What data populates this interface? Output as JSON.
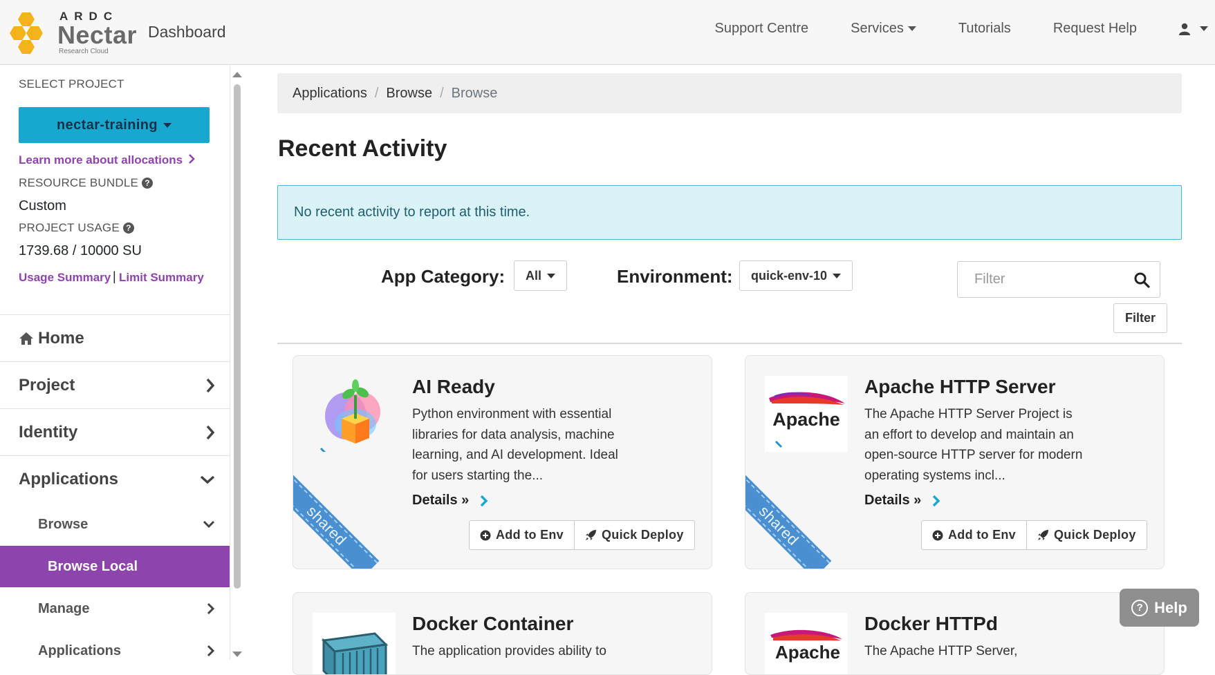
{
  "header": {
    "brand_small": "ARDC",
    "brand_big": "Nectar",
    "brand_sub": "Research Cloud",
    "dashboard_label": "Dashboard",
    "nav": [
      "Support Centre",
      "Services",
      "Tutorials",
      "Request Help"
    ],
    "brand_color": "#f4b21b"
  },
  "sidebar": {
    "select_project_label": "SELECT PROJECT",
    "project_name": "nectar-training",
    "learn_more": "Learn more about allocations",
    "resource_bundle_label": "RESOURCE BUNDLE",
    "resource_bundle_value": "Custom",
    "project_usage_label": "PROJECT USAGE",
    "project_usage_value": "1739.68 / 10000 SU",
    "usage_summary": "Usage Summary",
    "limit_summary": "Limit Summary",
    "separator": "|",
    "nav": {
      "home": "Home",
      "project": "Project",
      "identity": "Identity",
      "applications": "Applications",
      "browse": "Browse",
      "browse_local": "Browse Local",
      "manage": "Manage",
      "applications_sub": "Applications"
    },
    "accent": "#8e44ad",
    "project_button_color": "#17a7cf"
  },
  "breadcrumb": [
    "Applications",
    "Browse",
    "Browse"
  ],
  "main": {
    "title": "Recent Activity",
    "alert": "No recent activity to report at this time.",
    "app_category_label": "App Category:",
    "app_category_value": "All",
    "environment_label": "Environment:",
    "environment_value": "quick-env-10",
    "filter_placeholder": "Filter",
    "filter_button": "Filter"
  },
  "cards": [
    {
      "title": "AI Ready",
      "description": "Python environment with essential libraries for data analysis, machine learning, and AI development. Ideal for users starting the...",
      "details": "Details »",
      "add_to_env": "Add to Env",
      "quick_deploy": "Quick Deploy",
      "ribbon": "shared",
      "icon": "sprout-in-box-icon"
    },
    {
      "title": "Apache HTTP Server",
      "description": "The Apache HTTP Server Project is an effort to develop and maintain an open-source HTTP server for modern operating systems incl...",
      "details": "Details »",
      "add_to_env": "Add to Env",
      "quick_deploy": "Quick Deploy",
      "ribbon": "shared",
      "icon": "apache-feather-logo",
      "logo_text": "Apache"
    },
    {
      "title": "Docker Container",
      "description": "The application provides ability to",
      "icon": "shipping-container-icon"
    },
    {
      "title": "Docker HTTPd",
      "description": "The Apache HTTP Server,",
      "icon": "apache-feather-logo",
      "logo_text": "Apache"
    }
  ],
  "help_button": "Help"
}
